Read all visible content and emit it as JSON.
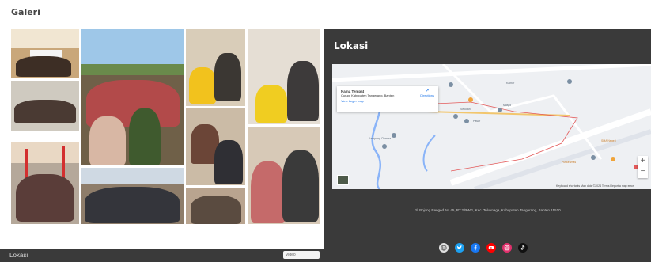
{
  "gallery": {
    "title": "Galeri"
  },
  "left_strip": {
    "label": "Lokasi",
    "mini_label": "Video"
  },
  "location": {
    "title": "Lokasi",
    "map": {
      "place_name": "Nama Tempat",
      "place_address": "Curug, Kabupaten Tangerang, Banten",
      "directions_label": "Directions",
      "view_larger_label": "View larger map",
      "zoom_in": "+",
      "zoom_out": "−",
      "footer": "Keyboard shortcuts  Map data ©2024  Terms  Report a map error",
      "labels": [
        "Kantor",
        "Sekolah",
        "Masjid",
        "Pasar",
        "Kampung Cijantra",
        "SMA Negeri",
        "Puskesmas"
      ]
    },
    "address": "Jl. Bojong Renged No.45, RT.2/RW.1, Kec. Teluknaga, Kabupaten Tangerang, Banten 15510",
    "socials": [
      {
        "icon": "globe-icon",
        "color": "#e0e0e0"
      },
      {
        "icon": "twitter-icon",
        "color": "#1da1f2"
      },
      {
        "icon": "facebook-icon",
        "color": "#1877f2"
      },
      {
        "icon": "youtube-icon",
        "color": "#ff0000"
      },
      {
        "icon": "instagram-icon",
        "color": "#e1306c"
      },
      {
        "icon": "tiktok-icon",
        "color": "#111111"
      }
    ]
  }
}
